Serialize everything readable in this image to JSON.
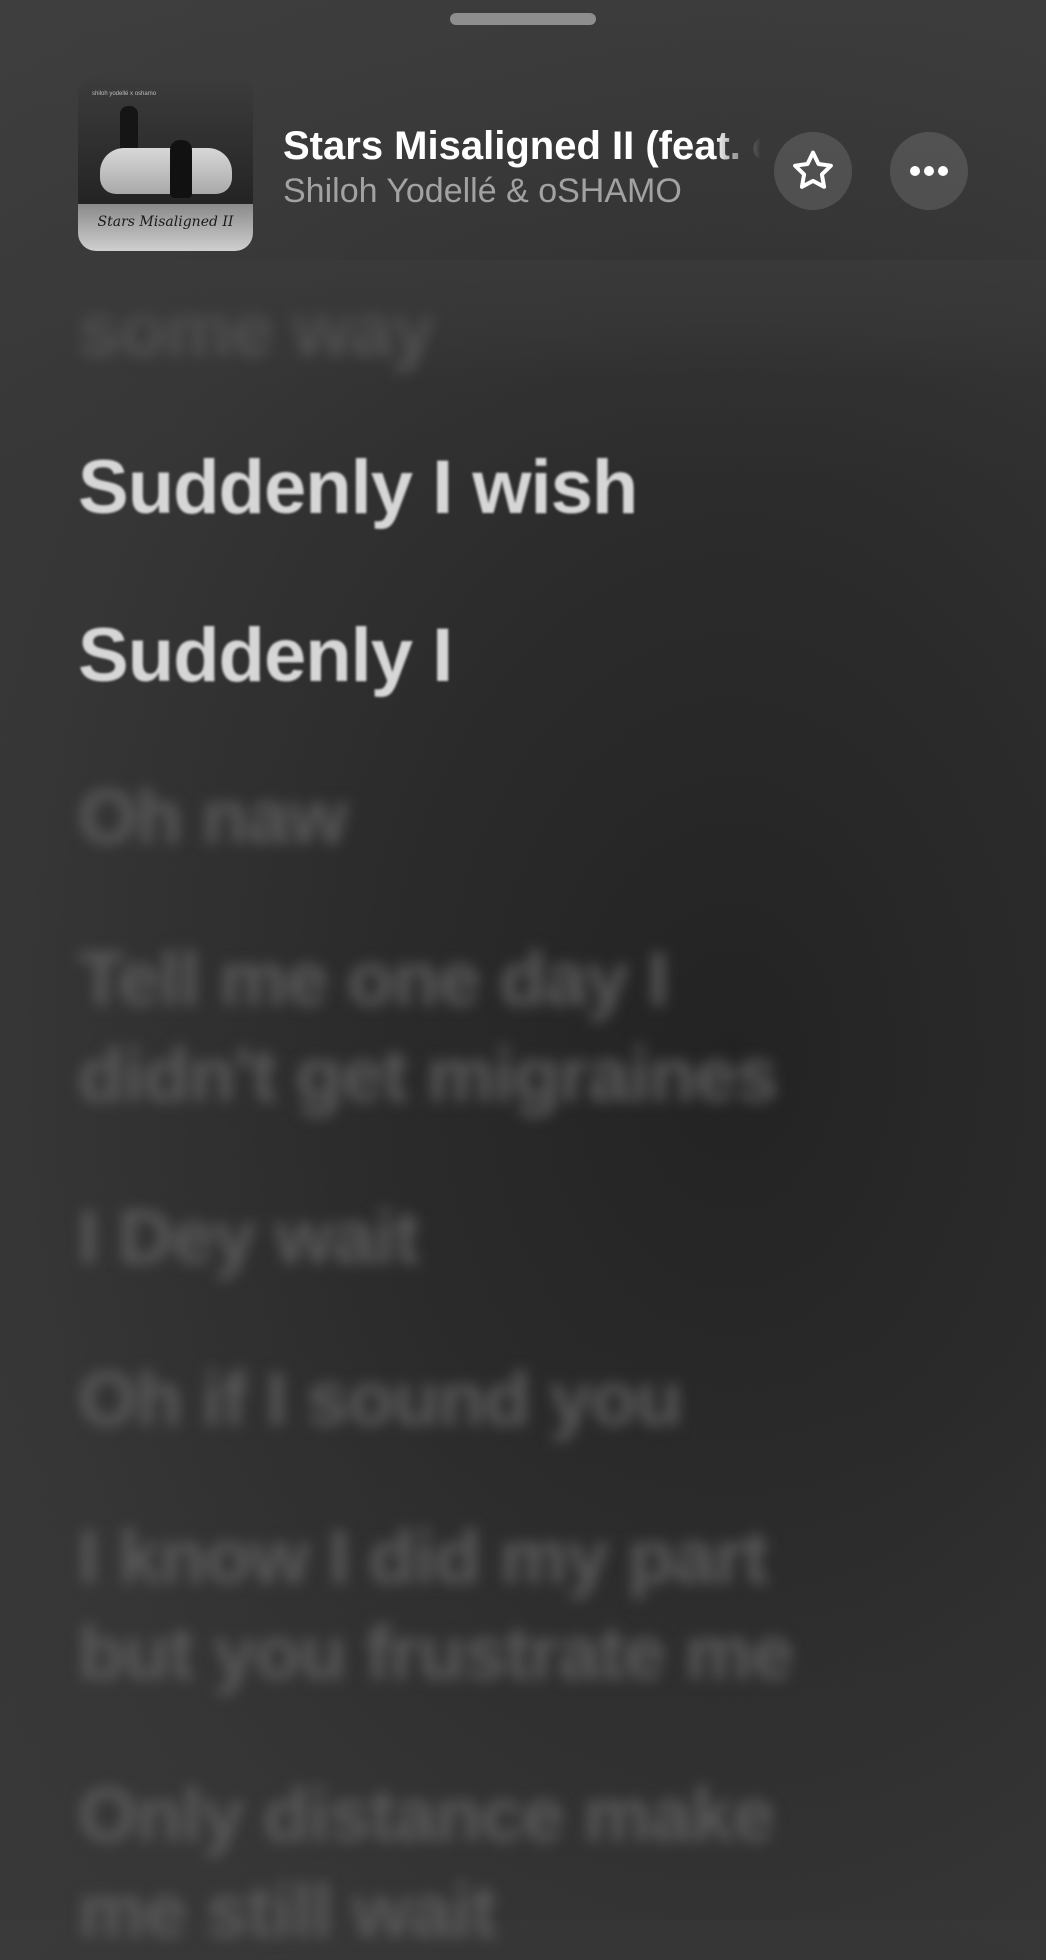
{
  "header": {
    "title": "Stars Misaligned II (feat. oSHAMO)",
    "artist": "Shiloh Yodellé & oSHAMO",
    "artwork": {
      "script_text": "Stars Misaligned II",
      "small_text": "shiloh yodellé x oshamo"
    },
    "star_icon": "star-outline-icon",
    "more_icon": "ellipsis-icon"
  },
  "lyrics": [
    {
      "text": "some way",
      "state": "blurred"
    },
    {
      "text": "Suddenly I wish",
      "state": "active"
    },
    {
      "text": "Suddenly I",
      "state": "active"
    },
    {
      "text": "Oh naw",
      "state": "blurred"
    },
    {
      "text": "Tell me one day I\ndidn't get migraines",
      "state": "blurred"
    },
    {
      "text": "I Dey wait",
      "state": "blurred"
    },
    {
      "text": "Oh if I sound you",
      "state": "blurred"
    },
    {
      "text": "I know I did my part\nbut you frustrate me",
      "state": "blurred"
    },
    {
      "text": "Only distance make\nme still wait",
      "state": "blurred"
    }
  ]
}
